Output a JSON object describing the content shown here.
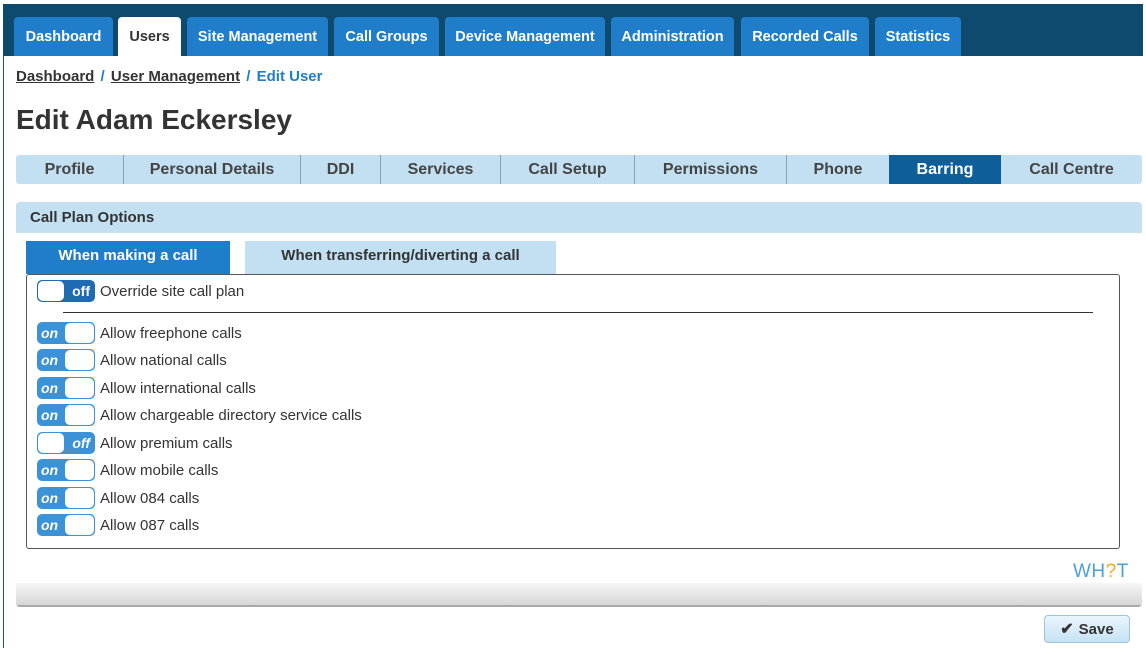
{
  "nav": {
    "tabs": [
      {
        "label": "Dashboard"
      },
      {
        "label": "Users"
      },
      {
        "label": "Site Management"
      },
      {
        "label": "Call Groups"
      },
      {
        "label": "Device Management"
      },
      {
        "label": "Administration"
      },
      {
        "label": "Recorded Calls"
      },
      {
        "label": "Statistics"
      }
    ],
    "active": "Users"
  },
  "breadcrumb": {
    "items": [
      "Dashboard",
      "User Management"
    ],
    "current": "Edit User",
    "separator": "/"
  },
  "page_title": "Edit Adam Eckersley",
  "subtabs": {
    "items": [
      {
        "label": "Profile"
      },
      {
        "label": "Personal Details"
      },
      {
        "label": "DDI"
      },
      {
        "label": "Services"
      },
      {
        "label": "Call Setup"
      },
      {
        "label": "Permissions"
      },
      {
        "label": "Phone"
      },
      {
        "label": "Barring"
      },
      {
        "label": "Call Centre"
      }
    ],
    "active": "Barring"
  },
  "panel": {
    "title": "Call Plan Options",
    "tabs": [
      {
        "label": "When making a call"
      },
      {
        "label": "When transferring/diverting a call"
      }
    ],
    "active_tab": "When making a call",
    "override": {
      "label": "Override site call plan",
      "state": "off"
    },
    "options": [
      {
        "label": "Allow freephone calls",
        "state": "on"
      },
      {
        "label": "Allow national calls",
        "state": "on"
      },
      {
        "label": "Allow international calls",
        "state": "on"
      },
      {
        "label": "Allow chargeable directory service calls",
        "state": "on"
      },
      {
        "label": "Allow premium calls",
        "state": "off"
      },
      {
        "label": "Allow mobile calls",
        "state": "on"
      },
      {
        "label": "Allow 084 calls",
        "state": "on"
      },
      {
        "label": "Allow 087 calls",
        "state": "on"
      }
    ]
  },
  "logo": {
    "text_a": "WH",
    "text_q": "?",
    "text_b": "T"
  },
  "save_button": {
    "label": "Save",
    "icon": "check-icon"
  },
  "colors": {
    "nav_bg": "#0d4a6e",
    "tab_blue": "#1f7dc9",
    "light_blue": "#c2e0f2",
    "active_subtab": "#0e5e9a"
  }
}
